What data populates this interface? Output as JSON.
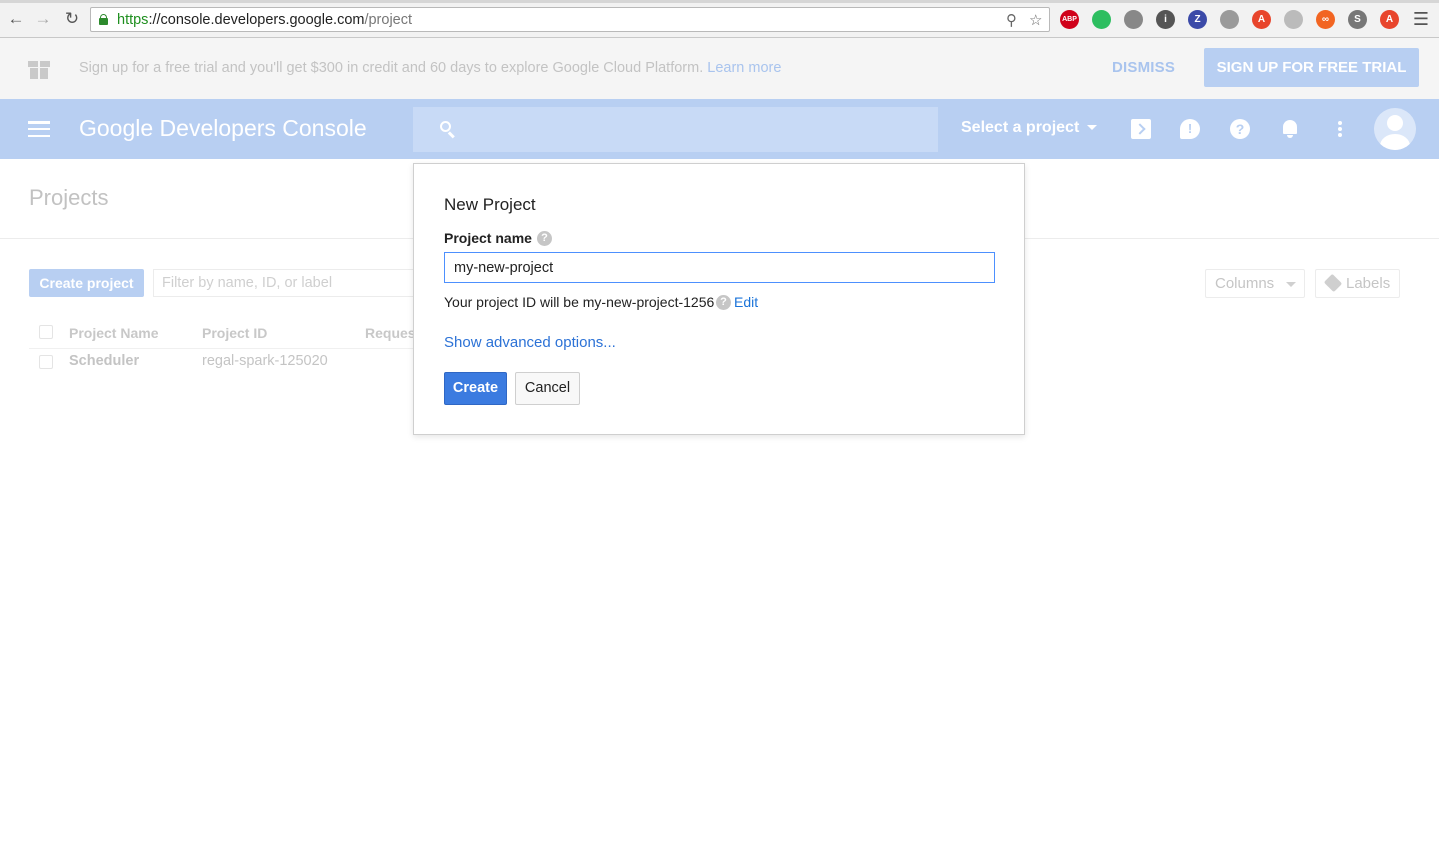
{
  "browser": {
    "url_scheme": "https",
    "url_host": "://console.developers.google.com",
    "url_path": "/project",
    "extensions": [
      {
        "name": "adblock-plus-icon",
        "label": "ABP",
        "color": "#d0021b"
      },
      {
        "name": "evernote-icon",
        "label": "",
        "color": "#2dbe60"
      },
      {
        "name": "globe-extension-icon",
        "label": "",
        "color": "#888888"
      },
      {
        "name": "info-extension-icon",
        "label": "i",
        "color": "#555555"
      },
      {
        "name": "zotero-icon",
        "label": "Z",
        "color": "#3b4aa8"
      },
      {
        "name": "beach-extension-icon",
        "label": "",
        "color": "#9a9a9a"
      },
      {
        "name": "a-extension-icon",
        "label": "A",
        "color": "#e8452c"
      },
      {
        "name": "feather-extension-icon",
        "label": "",
        "color": "#bbbbbb"
      },
      {
        "name": "infinity-extension-icon",
        "label": "∞",
        "color": "#f26522"
      },
      {
        "name": "s-extension-icon",
        "label": "S",
        "color": "#777777"
      },
      {
        "name": "a2-extension-icon",
        "label": "A",
        "color": "#e8452c"
      }
    ]
  },
  "banner": {
    "text": "Sign up for a free trial and you'll get $300 in credit and 60 days to explore Google Cloud Platform.",
    "learn_more": "Learn more",
    "dismiss": "DISMISS",
    "signup": "SIGN UP FOR FREE TRIAL"
  },
  "header": {
    "brand": "Google Developers Console",
    "project_selector": "Select a project"
  },
  "page": {
    "title": "Projects",
    "create_button": "Create project",
    "filter_placeholder": "Filter by name, ID, or label",
    "columns_button": "Columns",
    "labels_button": "Labels",
    "table": {
      "headers": [
        "Project Name",
        "Project ID",
        "Reques"
      ],
      "rows": [
        {
          "name": "Scheduler",
          "id": "regal-spark-125020"
        }
      ]
    }
  },
  "dialog": {
    "title": "New Project",
    "field_label": "Project name",
    "field_value": "my-new-project",
    "project_id_text": "Your project ID will be my-new-project-1256",
    "edit_link": "Edit",
    "advanced_link": "Show advanced options...",
    "create_button": "Create",
    "cancel_button": "Cancel"
  },
  "colors": {
    "brand_blue": "#3b7be0",
    "appbar_dimmed": "#b8cff2",
    "link_blue": "#1a73d9"
  }
}
